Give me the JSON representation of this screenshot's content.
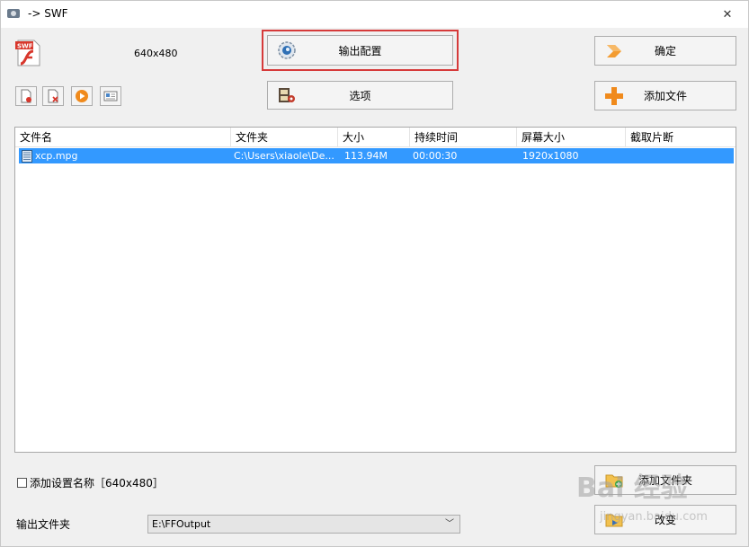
{
  "window": {
    "title": "-> SWF",
    "close_glyph": "✕"
  },
  "header": {
    "resolution": "640x480"
  },
  "buttons": {
    "output_config": "输出配置",
    "options": "选项",
    "confirm": "确定",
    "add_file": "添加文件",
    "add_folder": "添加文件夹",
    "change": "改变"
  },
  "toolbar": {
    "icons": [
      "remove-file-icon",
      "clear-list-icon",
      "play-icon",
      "media-info-icon"
    ]
  },
  "file_list": {
    "columns": [
      "文件名",
      "文件夹",
      "大小",
      "持续时间",
      "屏幕大小",
      "截取片断"
    ],
    "rows": [
      {
        "name": "xcp.mpg",
        "folder": "C:\\Users\\xiaole\\De...",
        "size": "113.94M",
        "duration": "00:00:30",
        "screen_size": "1920x1080",
        "clip": ""
      }
    ]
  },
  "options": {
    "add_setting_name_label": "添加设置名称［640x480］",
    "add_setting_name_checked": false
  },
  "output": {
    "label": "输出文件夹",
    "folder": "E:\\FFOutput"
  },
  "watermark": {
    "brand": "Bai 经验",
    "url": "jingyan.baidu.com"
  },
  "colors": {
    "selection": "#3399ff",
    "highlight_border": "#d63a3a",
    "confirm_arrow": "#f39c32",
    "add_plus": "#f08a1c"
  }
}
